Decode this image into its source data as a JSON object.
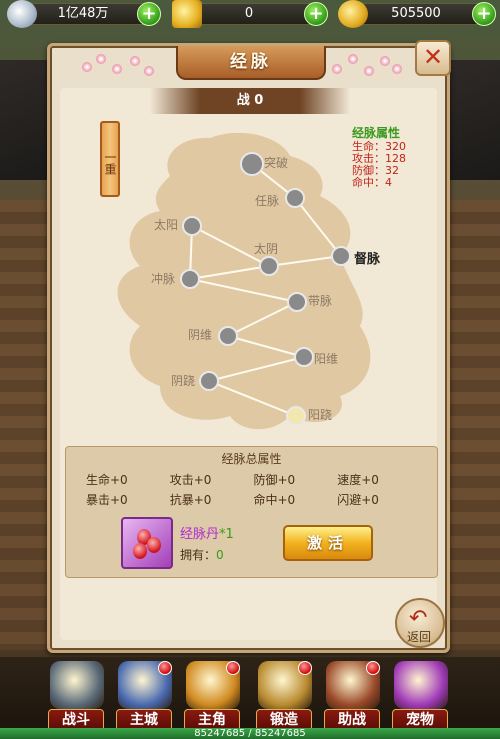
{
  "top_bar": {
    "silver": "1亿48万",
    "gold": "0",
    "ingot": "505500"
  },
  "panel": {
    "title": "经脉",
    "power": "战 0",
    "close_symbol": "✕",
    "level_tag": "一重"
  },
  "attributes": {
    "title": "经脉属性",
    "lines": [
      "生命：320",
      "攻击：128",
      "防御：32",
      "命中：4"
    ]
  },
  "nodes": [
    {
      "label": "突破"
    },
    {
      "label": "任脉"
    },
    {
      "label": "太阳"
    },
    {
      "label": "太阴"
    },
    {
      "label": "督脉"
    },
    {
      "label": "冲脉"
    },
    {
      "label": "带脉"
    },
    {
      "label": "阴维"
    },
    {
      "label": "阳维"
    },
    {
      "label": "阴跷"
    },
    {
      "label": "阳跷"
    }
  ],
  "total": {
    "title": "经脉总属性",
    "stats": [
      "生命+0",
      "攻击+0",
      "防御+0",
      "速度+0",
      "暴击+0",
      "抗暴+0",
      "命中+0",
      "闪避+0"
    ],
    "item_name": "经脉丹",
    "item_qty": "*1",
    "own_label": "拥有：",
    "own_value": "0",
    "activate": "激活"
  },
  "back_label": "返回",
  "bottom_nav": [
    {
      "label": "战斗",
      "color": "#5a6a78"
    },
    {
      "label": "主城",
      "color": "#4a6ab0"
    },
    {
      "label": "主角",
      "color": "#d08a20"
    },
    {
      "label": "锻造",
      "color": "#b88a30"
    },
    {
      "label": "助战",
      "color": "#9a4a2a"
    },
    {
      "label": "宠物",
      "color": "#a03ab8"
    }
  ],
  "hp_text": "85247685 / 85247685"
}
